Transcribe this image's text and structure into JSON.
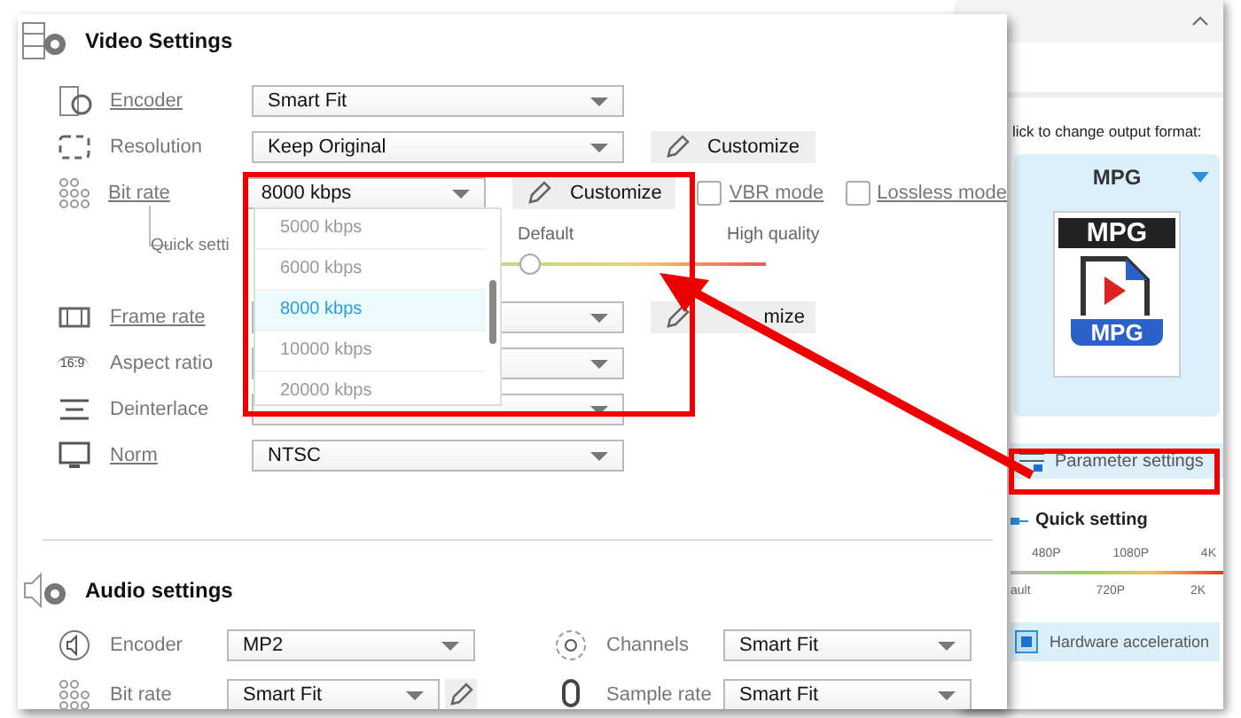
{
  "video_settings": {
    "title": "Video Settings",
    "rows": [
      {
        "kind": "select",
        "label": "Encoder",
        "link": true,
        "value": "Smart Fit"
      },
      {
        "kind": "select",
        "label": "Resolution",
        "link": false,
        "value": "Keep Original",
        "customize": "Customize"
      },
      {
        "kind": "bitrate",
        "label": "Bit rate",
        "link": true,
        "value": "8000 kbps",
        "customize": "Customize",
        "checkboxes": [
          {
            "label": "VBR mode",
            "checked": false
          },
          {
            "label": "Lossless mode",
            "checked": false
          }
        ]
      },
      {
        "kind": "quick",
        "label": "Quick setti",
        "marks": [
          "Default",
          "High quality"
        ],
        "level": 0.12
      },
      {
        "kind": "select",
        "label": "Frame rate",
        "link": true,
        "customize": "mize"
      },
      {
        "kind": "select",
        "icon_text": "16:9",
        "label": "Aspect ratio",
        "link": false
      },
      {
        "kind": "select",
        "label": "Deinterlace",
        "link": false
      },
      {
        "kind": "select",
        "label": "Norm",
        "link": true,
        "value": "NTSC"
      }
    ]
  },
  "bitrate_dropdown": {
    "options": [
      {
        "label": "5000 kbps",
        "selected": false
      },
      {
        "label": "6000 kbps",
        "selected": false
      },
      {
        "label": "8000 kbps",
        "selected": true
      },
      {
        "label": "10000 kbps",
        "selected": false
      },
      {
        "label": "20000 kbps",
        "selected": false
      }
    ]
  },
  "audio_settings": {
    "title": "Audio settings",
    "rows": [
      {
        "left": {
          "label": "Encoder",
          "value": "MP2"
        },
        "right": {
          "label": "Channels",
          "value": "Smart Fit"
        }
      },
      {
        "left": {
          "label": "Bit rate",
          "value": "Smart Fit",
          "edit": true
        },
        "right": {
          "label": "Sample rate",
          "value": "Smart Fit"
        }
      }
    ]
  },
  "side_panel": {
    "hint": "lick to change output format:",
    "format": {
      "name": "MPG",
      "icon_top": "MPG",
      "icon_bottom": "MPG"
    },
    "parameter_settings": "Parameter settings",
    "quick_setting": {
      "title": "Quick setting",
      "top_ticks": [
        "480P",
        "1080P",
        "4K"
      ],
      "bottom_ticks": [
        "ault",
        "720P",
        "2K"
      ]
    },
    "hardware_acceleration": "Hardware acceleration"
  }
}
